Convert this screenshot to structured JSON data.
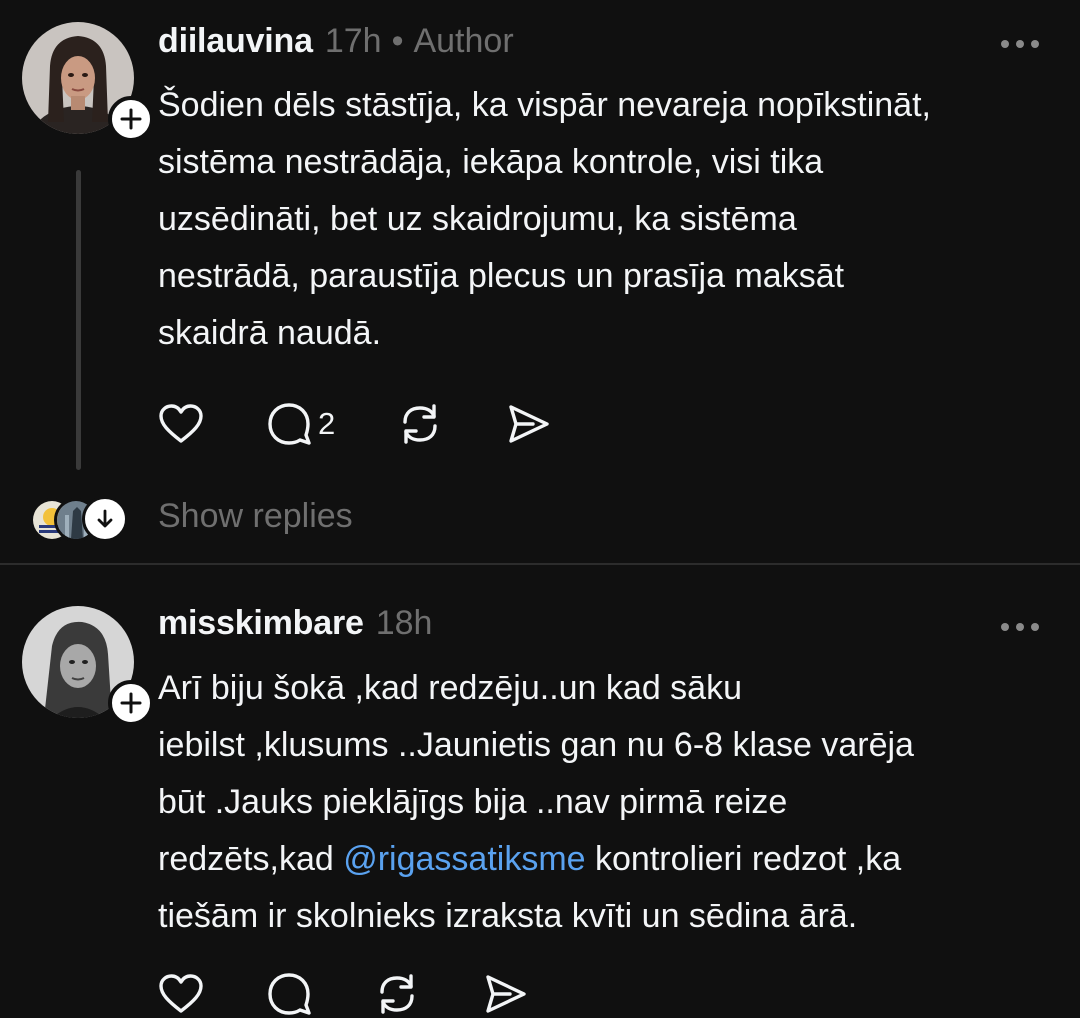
{
  "posts": [
    {
      "username": "diilauvina",
      "time": "17h",
      "separator": "•",
      "role": "Author",
      "text": "Šodien dēls stāstīja, ka vispār nevareja nopīkstināt,\nsistēma nestrādāja, iekāpa kontrole, visi tika\nuzsēdināti, bet uz skaidrojumu, ka sistēma\nnestrādā, paraustīja plecus un prasīja maksāt\nskaidrā naudā.",
      "reply_count": "2",
      "show_replies_label": "Show replies",
      "icons": [
        "heart-icon",
        "comment-icon",
        "repost-icon",
        "share-icon",
        "more-icon",
        "plus-icon",
        "arrow-down-icon"
      ]
    },
    {
      "username": "misskimbare",
      "time": "18h",
      "text_lines": [
        "Arī biju šokā ,kad redzēju..un kad sāku",
        "iebilst ,klusums ..Jaunietis gan nu 6-8 klase varēja",
        "būt .Jauks pieklājīgs bija ..nav pirmā reize"
      ],
      "text_line4_before": "redzēts,kad ",
      "mention": "@rigassatiksme",
      "text_line4_after": " kontrolieri redzot ,ka",
      "text_line5": "tiešām ir skolnieks izraksta kvīti un sēdina ārā.",
      "icons": [
        "heart-icon",
        "comment-icon",
        "repost-icon",
        "share-icon",
        "more-icon",
        "plus-icon"
      ]
    }
  ],
  "colors": {
    "background": "#101010",
    "text": "#f3f5f7",
    "muted": "#6f6f6f",
    "mention": "#5aa2f0",
    "divider": "#2c2c2c"
  }
}
